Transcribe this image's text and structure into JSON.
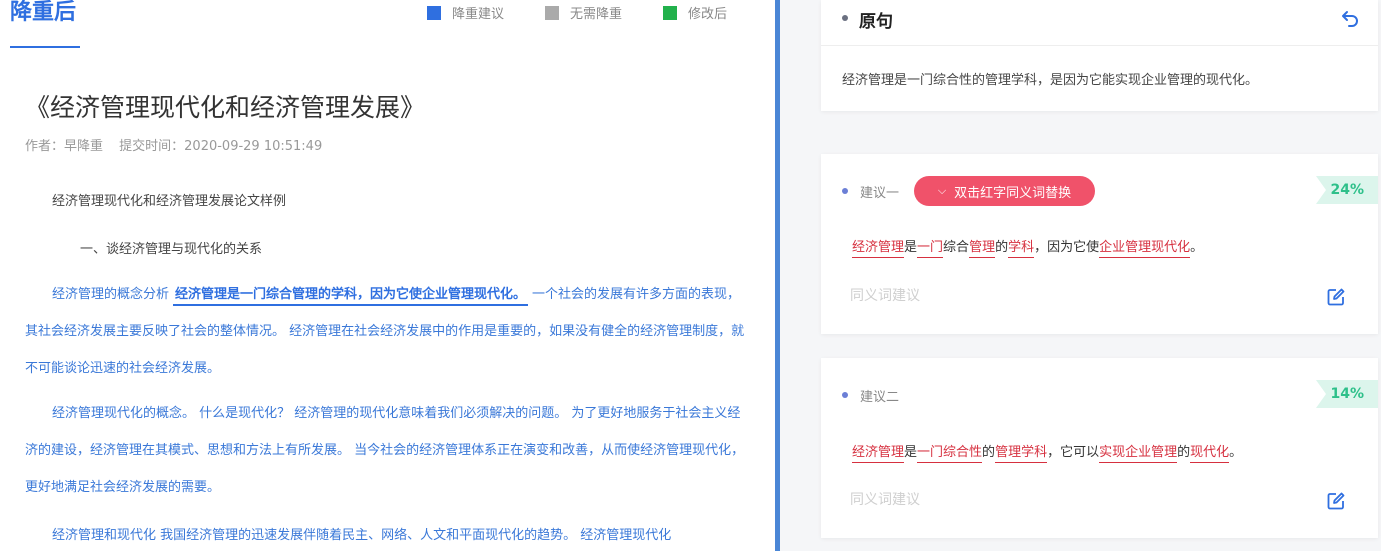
{
  "header": {
    "title": "降重后",
    "legend": [
      {
        "label": "降重建议",
        "color": "#2f6fe0"
      },
      {
        "label": "无需降重",
        "color": "#aaaaaa"
      },
      {
        "label": "修改后",
        "color": "#22b14c"
      }
    ]
  },
  "document": {
    "title": "《经济管理现代化和经济管理发展》",
    "author": "作者：早降重",
    "submit_time": "提交时间：2020-09-29 10:51:49",
    "lines": [
      "经济管理现代化和经济管理发展论文样例",
      "一、谈经济管理与现代化的关系"
    ],
    "para1": {
      "before": "经济管理的概念分析",
      "highlight": "经济管理是一门综合管理的学科，因为它使企业管理现代化。",
      "after": "一个社会的发展有许多方面的表现，其社会经济发展主要反映了社会的整体情况。 经济管理在社会经济发展中的作用是重要的，如果没有健全的经济管理制度，就不可能谈论迅速的社会经济发展。"
    },
    "para2": "经济管理现代化的概念。 什么是现代化？ 经济管理的现代化意味着我们必须解决的问题。 为了更好地服务于社会主义经济的建设，经济管理在其模式、思想和方法上有所发展。 当今社会的经济管理体系正在演变和改善，从而使经济管理现代化，更好地满足社会经济发展的需要。",
    "para3": "经济管理和现代化 我国经济管理的迅速发展伴随着民主、网络、人文和平面现代化的趋势。 经济管理现代化"
  },
  "original": {
    "title": "原句",
    "text": "经济管理是一门综合性的管理学科，是因为它能实现企业管理的现代化。",
    "undo_icon": "undo-icon"
  },
  "suggestions": [
    {
      "label": "建议一",
      "pill": "双击红字同义词替换",
      "percent": "24%",
      "segments": [
        {
          "t": "经济管理",
          "red": true
        },
        {
          "t": "是",
          "red": false
        },
        {
          "t": "一门",
          "red": true
        },
        {
          "t": "综合",
          "red": false
        },
        {
          "t": "管理",
          "red": true
        },
        {
          "t": "的",
          "red": false
        },
        {
          "t": "学科",
          "red": true
        },
        {
          "t": "，因为它使",
          "red": false
        },
        {
          "t": "企业管理现代化",
          "red": true
        },
        {
          "t": "。",
          "red": false
        }
      ],
      "synonym_placeholder": "同义词建议"
    },
    {
      "label": "建议二",
      "percent": "14%",
      "segments": [
        {
          "t": "经济管理",
          "red": true
        },
        {
          "t": "是",
          "red": false
        },
        {
          "t": "一门综合性",
          "red": true
        },
        {
          "t": "的",
          "red": false
        },
        {
          "t": "管理学科",
          "red": true
        },
        {
          "t": "，它可以",
          "red": false
        },
        {
          "t": "实现企业管理",
          "red": true
        },
        {
          "t": "的",
          "red": false
        },
        {
          "t": "现代化",
          "red": true
        },
        {
          "t": "。",
          "red": false
        }
      ],
      "synonym_placeholder": "同义词建议"
    }
  ]
}
